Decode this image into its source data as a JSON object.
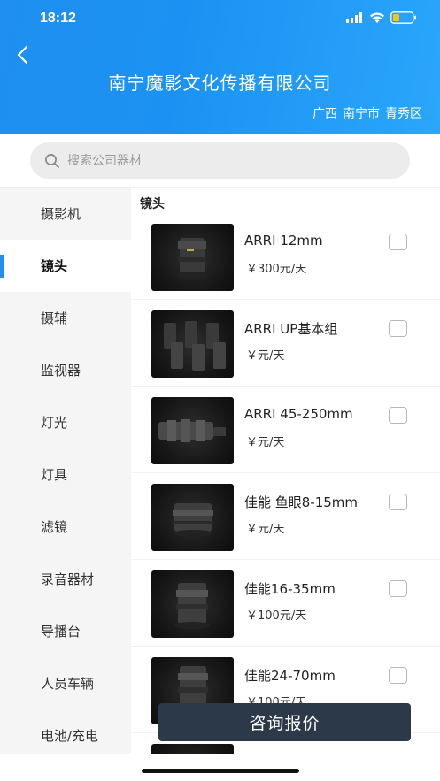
{
  "status_bar": {
    "time": "18:12"
  },
  "header": {
    "company_name": "南宁魔影文化传播有限公司",
    "province": "广西",
    "city": "南宁市",
    "district": "青秀区"
  },
  "search": {
    "placeholder": "搜索公司器材"
  },
  "sidebar": {
    "items": [
      {
        "label": "摄影机"
      },
      {
        "label": "镜头"
      },
      {
        "label": "摄辅"
      },
      {
        "label": "监视器"
      },
      {
        "label": "灯光"
      },
      {
        "label": "灯具"
      },
      {
        "label": "滤镜"
      },
      {
        "label": "录音器材"
      },
      {
        "label": "导播台"
      },
      {
        "label": "人员车辆"
      },
      {
        "label": "电池/充电"
      }
    ],
    "active_index": 1
  },
  "content": {
    "section_title": "镜头",
    "products": [
      {
        "name": "ARRI 12mm",
        "price": "￥300元/天"
      },
      {
        "name": "ARRI UP基本组",
        "price": "￥元/天"
      },
      {
        "name": "ARRI 45-250mm",
        "price": "￥元/天"
      },
      {
        "name": "佳能 鱼眼8-15mm",
        "price": "￥元/天"
      },
      {
        "name": "佳能16-35mm",
        "price": "￥100元/天"
      },
      {
        "name": "佳能24-70mm",
        "price": "￥100元/天"
      }
    ]
  },
  "footer": {
    "consult_label": "咨询报价"
  },
  "colors": {
    "header_blue": "#1f8ff0",
    "button_dark": "#2c3948",
    "sidebar_bg": "#f5f5f5"
  }
}
